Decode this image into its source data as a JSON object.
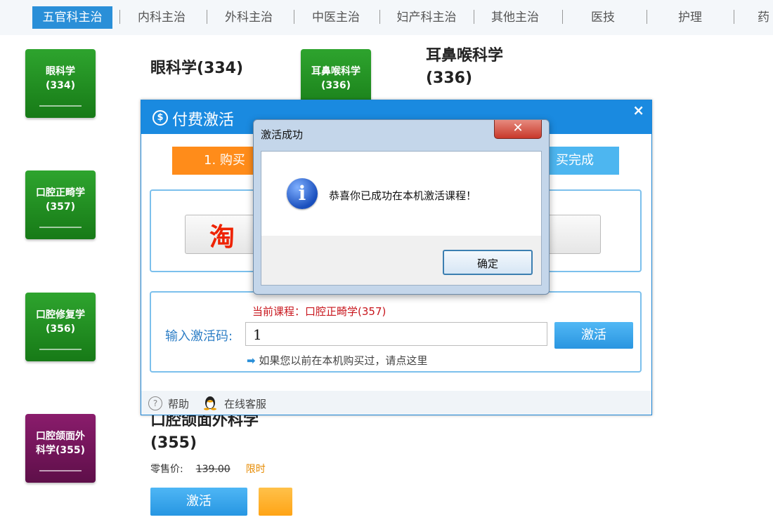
{
  "nav": {
    "items": [
      "五官科主治",
      "内科主治",
      "外科主治",
      "中医主治",
      "妇产科主治",
      "其他主治",
      "医技",
      "护理",
      "药"
    ]
  },
  "courses": [
    {
      "tile_line1": "眼科学",
      "tile_line2": "(334)",
      "title_line1": "眼科学(334)",
      "title_line2": ""
    },
    {
      "tile_line1": "耳鼻喉科学",
      "tile_line2": "(336)",
      "title_line1": "耳鼻喉科学",
      "title_line2": "(336)"
    },
    {
      "tile_line1": "口腔正畸学",
      "tile_line2": "(357)"
    },
    {
      "tile_line1": "口腔修复学",
      "tile_line2": "(356)"
    },
    {
      "tile_line1": "口腔颌面外",
      "tile_line2": "科学(355)",
      "title_line1": "口腔颌面外科学",
      "title_line2": "(355)",
      "price_label": "零售价:",
      "old_price": "139.00",
      "limited": "限时"
    }
  ],
  "course_actions": {
    "activate_label": "激活"
  },
  "pay_dialog": {
    "title": "付费激活",
    "close": "×",
    "step1": "1. 购买",
    "step3": "买完成",
    "taobao_glyph": "淘",
    "current_course": "当前课程：口腔正畸学(357)",
    "code_label": "输入激活码:",
    "code_value": "1",
    "activate_label": "激活",
    "hint": "如果您以前在本机购买过，请点这里",
    "help_label": "帮助",
    "service_label": "在线客服"
  },
  "message_box": {
    "title": "激活成功",
    "close": "✕",
    "message": "恭喜你已成功在本机激活课程！",
    "ok_label": "确定"
  },
  "colors": {
    "nav_active": "#2a8fd8",
    "dialog_header": "#1a8ae0",
    "tile_green": "#1f8f1f",
    "tile_purple": "#7a1760",
    "step_orange": "#ff8c1a"
  }
}
